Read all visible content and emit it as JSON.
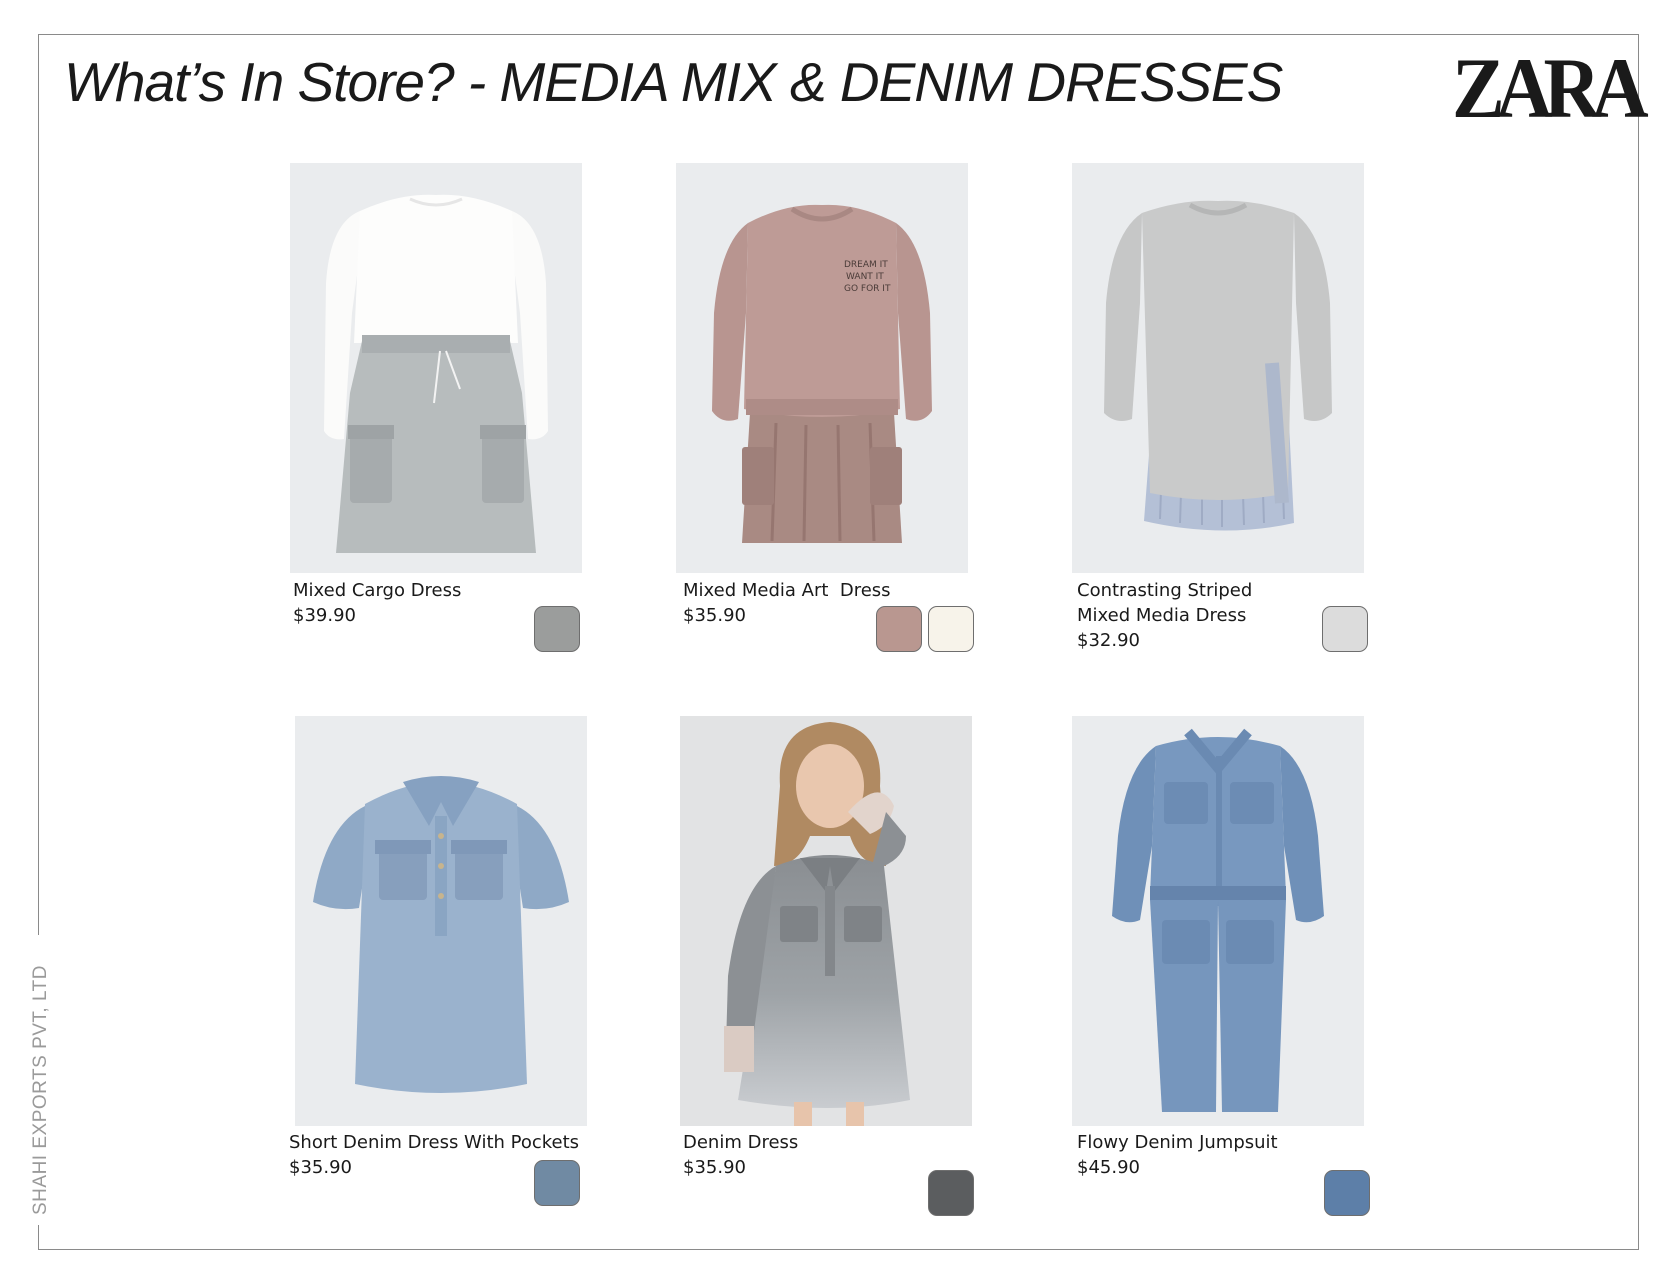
{
  "header": {
    "title": "What’s In Store? - MEDIA MIX  & DENIM DRESSES",
    "brand_logo": "ZARA"
  },
  "side_label": "SHAHI EXPORTS PVT, LTD",
  "products": [
    {
      "name": "Mixed Cargo Dress",
      "price": "$39.90",
      "swatches": [
        {
          "color": "#9b9d9c"
        }
      ],
      "image_desc": "white long-sleeve top with grey cargo skirt"
    },
    {
      "name": "Mixed Media Art  Dress",
      "price": "$35.90",
      "swatches": [
        {
          "color": "#b99790"
        },
        {
          "color": "#f7f3ea"
        }
      ],
      "image_desc": "mauve sweatshirt dress with pleated skirt",
      "print_text": "DREAM IT\nWANT IT\nGO FOR IT"
    },
    {
      "name_lines": [
        "Contrasting Striped",
        "Mixed Media Dress"
      ],
      "price": "$32.90",
      "swatches": [
        {
          "color": "#dcdcdc"
        }
      ],
      "image_desc": "grey sweatshirt dress with striped shirt hem"
    },
    {
      "name": "Short Denim Dress With Pockets",
      "price": "$35.90",
      "swatches": [
        {
          "color": "#708aa3"
        }
      ],
      "image_desc": "light blue denim short-sleeve shirt dress"
    },
    {
      "name": "Denim Dress",
      "price": "$35.90",
      "swatches": [
        {
          "color": "#5b5d5f"
        }
      ],
      "image_desc": "girl wearing grey ombre denim dress"
    },
    {
      "name": "Flowy Denim Jumpsuit",
      "price": "$45.90",
      "swatches": [
        {
          "color": "#5d7fa8"
        }
      ],
      "image_desc": "blue denim long-sleeve jumpsuit"
    }
  ]
}
